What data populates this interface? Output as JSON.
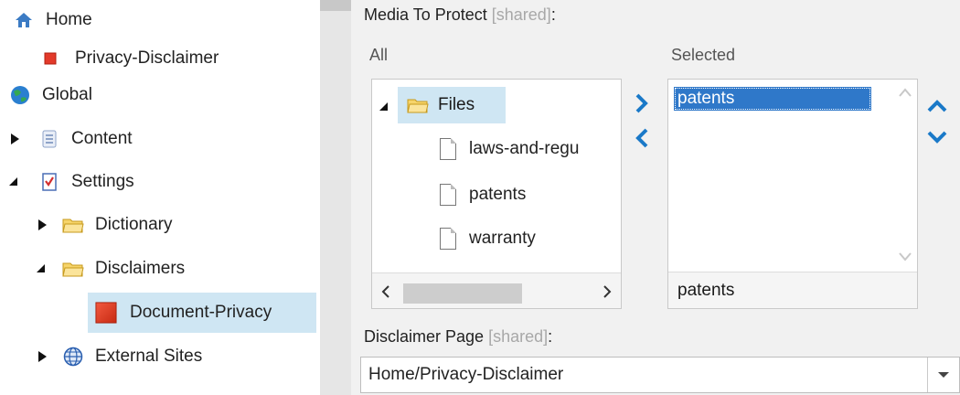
{
  "tree": {
    "items": [
      {
        "label": "Home",
        "icon": "home-icon"
      },
      {
        "label": "Privacy-Disclaimer",
        "icon": "red-square-icon"
      },
      {
        "label": "Global",
        "icon": "globe-icon"
      },
      {
        "label": "Content",
        "icon": "content-icon"
      },
      {
        "label": "Settings",
        "icon": "settings-icon"
      },
      {
        "label": "Dictionary",
        "icon": "folder-icon"
      },
      {
        "label": "Disclaimers",
        "icon": "folder-icon"
      },
      {
        "label": "Document-Privacy",
        "icon": "red-square-icon"
      },
      {
        "label": "External Sites",
        "icon": "globe-icon"
      }
    ]
  },
  "media": {
    "label": "Media To Protect",
    "shared": "[shared]",
    "colon": ":",
    "all_header": "All",
    "selected_header": "Selected",
    "folder": "Files",
    "files": [
      "laws-and-regu",
      "patents",
      "warranty"
    ],
    "selected_items": [
      "patents"
    ],
    "selected_footer": "patents"
  },
  "disclaimer": {
    "label": "Disclaimer Page",
    "shared": "[shared]",
    "colon": ":",
    "value": "Home/Privacy-Disclaimer"
  },
  "colors": {
    "accent": "#1a79c8",
    "selection": "#2f78c9",
    "highlight": "#cfe6f3"
  }
}
